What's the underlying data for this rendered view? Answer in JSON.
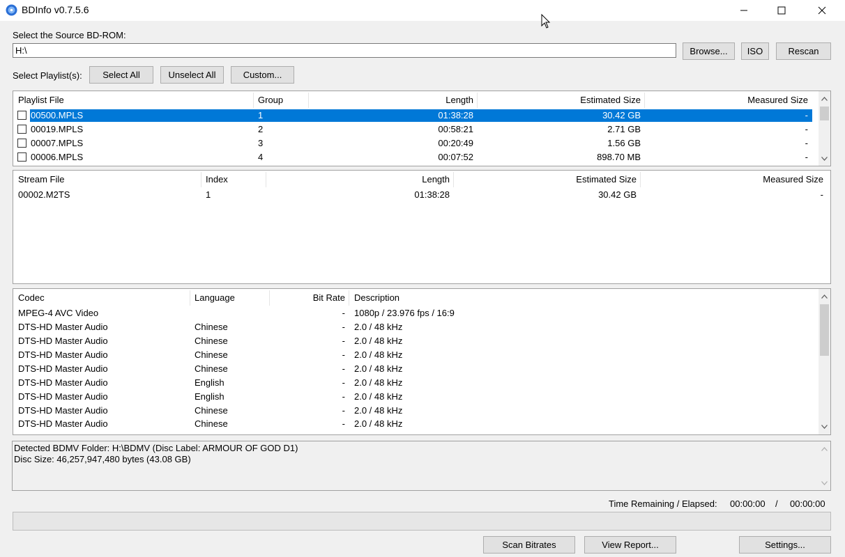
{
  "window": {
    "title": "BDInfo v0.7.5.6",
    "controls": [
      "minimize",
      "maximize",
      "close"
    ]
  },
  "source": {
    "label": "Select the Source BD-ROM:",
    "path_value": "H:\\",
    "browse_label": "Browse...",
    "iso_label": "ISO",
    "rescan_label": "Rescan"
  },
  "playlist_controls": {
    "label": "Select Playlist(s):",
    "select_all_label": "Select All",
    "unselect_all_label": "Unselect All",
    "custom_label": "Custom..."
  },
  "playlists": {
    "columns": [
      "Playlist File",
      "Group",
      "Length",
      "Estimated Size",
      "Measured Size"
    ],
    "rows": [
      {
        "file": "00500.MPLS",
        "group": "1",
        "length": "01:38:28",
        "est": "30.42 GB",
        "measured": "-",
        "selected": true
      },
      {
        "file": "00019.MPLS",
        "group": "2",
        "length": "00:58:21",
        "est": "2.71 GB",
        "measured": "-",
        "selected": false
      },
      {
        "file": "00007.MPLS",
        "group": "3",
        "length": "00:20:49",
        "est": "1.56 GB",
        "measured": "-",
        "selected": false
      },
      {
        "file": "00006.MPLS",
        "group": "4",
        "length": "00:07:52",
        "est": "898.70 MB",
        "measured": "-",
        "selected": false
      }
    ]
  },
  "streams": {
    "columns": [
      "Stream File",
      "Index",
      "Length",
      "Estimated Size",
      "Measured Size"
    ],
    "rows": [
      {
        "file": "00002.M2TS",
        "index": "1",
        "length": "01:38:28",
        "est": "30.42 GB",
        "measured": "-"
      }
    ]
  },
  "codecs": {
    "columns": [
      "Codec",
      "Language",
      "Bit Rate",
      "Description"
    ],
    "rows": [
      {
        "codec": "MPEG-4 AVC Video",
        "language": "",
        "bitrate": "-",
        "desc": "1080p / 23.976 fps / 16:9"
      },
      {
        "codec": "DTS-HD Master Audio",
        "language": "Chinese",
        "bitrate": "-",
        "desc": "2.0 / 48 kHz"
      },
      {
        "codec": "DTS-HD Master Audio",
        "language": "Chinese",
        "bitrate": "-",
        "desc": "2.0 / 48 kHz"
      },
      {
        "codec": "DTS-HD Master Audio",
        "language": "Chinese",
        "bitrate": "-",
        "desc": "2.0 / 48 kHz"
      },
      {
        "codec": "DTS-HD Master Audio",
        "language": "Chinese",
        "bitrate": "-",
        "desc": "2.0 / 48 kHz"
      },
      {
        "codec": "DTS-HD Master Audio",
        "language": "English",
        "bitrate": "-",
        "desc": "2.0 / 48 kHz"
      },
      {
        "codec": "DTS-HD Master Audio",
        "language": "English",
        "bitrate": "-",
        "desc": "2.0 / 48 kHz"
      },
      {
        "codec": "DTS-HD Master Audio",
        "language": "Chinese",
        "bitrate": "-",
        "desc": "2.0 / 48 kHz"
      },
      {
        "codec": "DTS-HD Master Audio",
        "language": "Chinese",
        "bitrate": "-",
        "desc": "2.0 / 48 kHz"
      }
    ]
  },
  "info": {
    "line1": "Detected BDMV Folder: H:\\BDMV (Disc Label: ARMOUR OF GOD D1)",
    "line2": "Disc Size: 46,257,947,480 bytes (43.08 GB)"
  },
  "status": {
    "time_label": "Time Remaining / Elapsed:",
    "remaining": "00:00:00",
    "separator": "/",
    "elapsed": "00:00:00",
    "progress_fraction": 0
  },
  "bottom_buttons": {
    "scan_label": "Scan Bitrates",
    "report_label": "View Report...",
    "settings_label": "Settings..."
  },
  "colors": {
    "selection": "#0078d7",
    "window_bg": "#f0f0f0"
  },
  "icons": {
    "app": "bluray-disc-icon",
    "minimize": "minimize-icon",
    "maximize": "maximize-icon",
    "close": "close-icon"
  }
}
